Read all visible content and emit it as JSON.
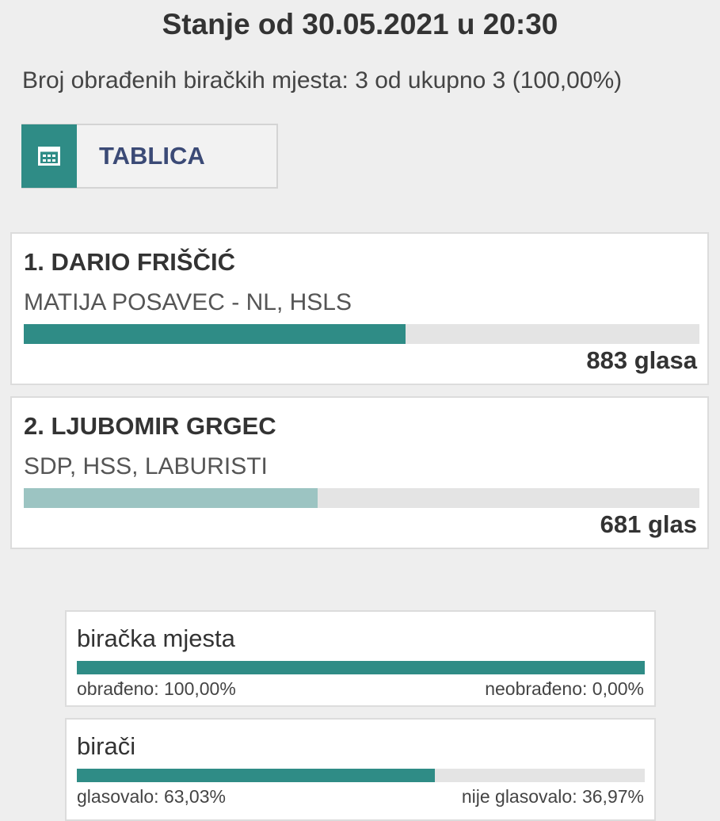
{
  "header": {
    "title": "Stanje od 30.05.2021 u 20:30",
    "processed": "Broj obrađenih biračkih mjesta: 3 od ukupno 3 (100,00%)"
  },
  "tabs": {
    "table_label": "TABLICA",
    "icon": "table-grid-icon"
  },
  "candidates": [
    {
      "name": "1. DARIO FRIŠČIĆ",
      "party": "MATIJA POSAVEC - NL, HSLS",
      "votes_text": "883 glasa",
      "share": 0.5646,
      "color": "#2f8c86"
    },
    {
      "name": "2. LJUBOMIR GRGEC",
      "party": "SDP, HSS, LABURISTI",
      "votes_text": "681 glas",
      "share": 0.4354,
      "color": "#9cc4c2"
    }
  ],
  "stats": [
    {
      "title": "biračka mjesta",
      "left_label": "obrađeno: 100,00%",
      "right_label": "neobrađeno: 0,00%",
      "fill": 1.0
    },
    {
      "title": "birači",
      "left_label": "glasovalo: 63,03%",
      "right_label": "nije glasovalo: 36,97%",
      "fill": 0.6303
    }
  ],
  "colors": {
    "accent": "#2f8c86",
    "secondary": "#9cc4c2",
    "tab_text": "#3b4a76"
  }
}
